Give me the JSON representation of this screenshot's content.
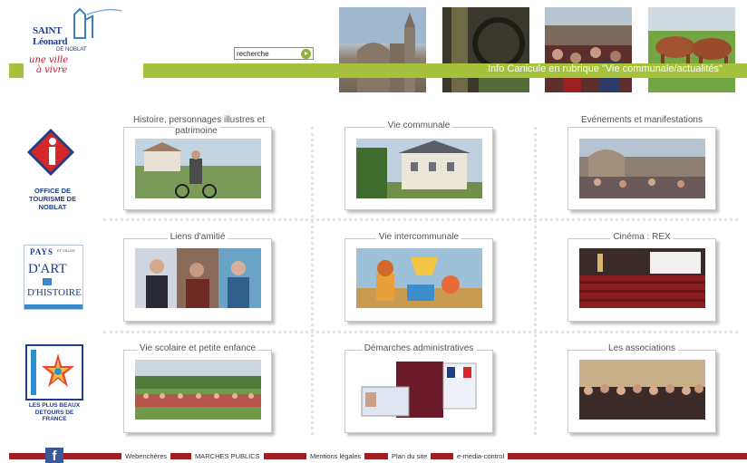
{
  "header": {
    "logo": {
      "line1": "SAINT",
      "line2": "Léonard",
      "line3": "DE NOBLAT",
      "slogan1": "une ville",
      "slogan2": "à vivre"
    },
    "search": {
      "value": "recherche"
    },
    "ticker": "Info Canicule en rubrique \"Vie communale/actualités\""
  },
  "side_logos": {
    "office_tourisme": "OFFICE DE TOURISME DE NOBLAT",
    "pays_art_histoire": {
      "pays": "PAYS",
      "villes": "ET VILLES",
      "art": "D'ART",
      "et": "ET",
      "histoire": "D'HISTOIRE"
    },
    "plus_beaux_detours": "LES PLUS BEAUX DETOURS DE FRANCE"
  },
  "tiles": [
    {
      "title": "Histoire, personnages illustres et patrimoine"
    },
    {
      "title": "Vie communale"
    },
    {
      "title": "Evénements et manifestations"
    },
    {
      "title": "Liens d'amitié"
    },
    {
      "title": "Vie intercommunale"
    },
    {
      "title": "Cinéma : REX"
    },
    {
      "title": "Vie scolaire et petite enfance"
    },
    {
      "title": "Démarches administratives"
    },
    {
      "title": "Les associations"
    }
  ],
  "footer": {
    "facebook": "f",
    "links": [
      "Webenchères",
      "MARCHES PUBLICS",
      "Mentions légales",
      "Plan du site",
      "e-media-control"
    ]
  },
  "colors": {
    "accent_green": "#a6c13c",
    "footer_red": "#a11e22",
    "brand_blue": "#1f3f8a"
  }
}
